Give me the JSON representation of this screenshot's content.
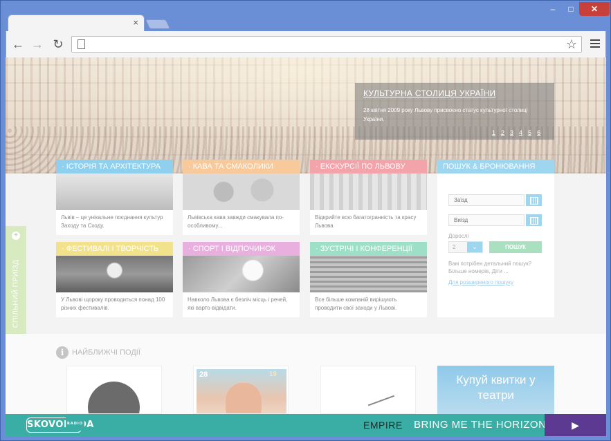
{
  "browser": {
    "tab_close": "×",
    "win_min": "–",
    "win_max": "□",
    "win_close": "✕",
    "back": "←",
    "forward": "→",
    "reload": "↻",
    "star": "☆"
  },
  "hero": {
    "slide_title": "КУЛЬТУРНА СТОЛИЦЯ УКРАЇНИ",
    "slide_text": "28 квітня 2009 року Львову присвоєно статус культурної столиці України.",
    "pages": [
      "1",
      "2",
      "3",
      "4",
      "5",
      "6"
    ]
  },
  "cards": [
    {
      "title": "· ІСТОРІЯ ТА АРХІТЕКТУРА",
      "text": "Львів – це унікальне поєднання культур Заходу та Сходу."
    },
    {
      "title": "· КАВА ТА СМАКОЛИКИ",
      "text": "Львівська кава завжди смакувала по-особливому..."
    },
    {
      "title": "· ЕКСКУРСІЇ ПО ЛЬВОВУ",
      "text": "Відкрийте всю багатогранність та красу Львова"
    },
    {
      "title": "· ФЕСТИВАЛІ І ТВОРЧІСТЬ",
      "text": "У Львові щороку проводиться понад 100 різних фестивалів."
    },
    {
      "title": "· СПОРТ І ВІДПОЧИНОК",
      "text": "Навколо Львова є безліч місць і речей, які варто відвідати."
    },
    {
      "title": "· ЗУСТРІЧІ І КОНФЕРЕНЦІЇ",
      "text": "Все більше компаній вирішують проводити свої заходи у Львові."
    }
  ],
  "booking": {
    "title": "ПОШУК & БРОНЮВАННЯ",
    "checkin_placeholder": "Заїзд",
    "checkout_placeholder": "Виїзд",
    "adults_label": "Дорослі",
    "adults_value": "2",
    "search_label": "ПОШУК",
    "note": "Вам потрібен детальний пошук? Більше номерів, Діти ...",
    "advanced_link": "Для розширеного пошуку"
  },
  "sidetab": {
    "label": "СПІЛЬНИЙ ПРИЇЗД",
    "plus": "+"
  },
  "events": {
    "info_glyph": "i",
    "title": "НАЙБЛИЖЧІ ПОДІЇ",
    "poster_date_left": "28",
    "poster_date_right": "19",
    "ad_text": "Купуй квитки у театри"
  },
  "player": {
    "logo": "SKOVORODA",
    "logo_radio": "RADIO",
    "artist": "EMPIRE",
    "track": "BRING ME THE HORIZON",
    "play": "▶"
  },
  "colors": {
    "history": "#8fd0ee",
    "food": "#f8c99b",
    "excursions": "#f3a4ab",
    "festivals": "#f3e28c",
    "sport": "#e9b0df",
    "meetings": "#9edfc7",
    "booking": "#9fd6ef",
    "player_bg": "#3aaea4",
    "play_button": "#5d3a91"
  }
}
